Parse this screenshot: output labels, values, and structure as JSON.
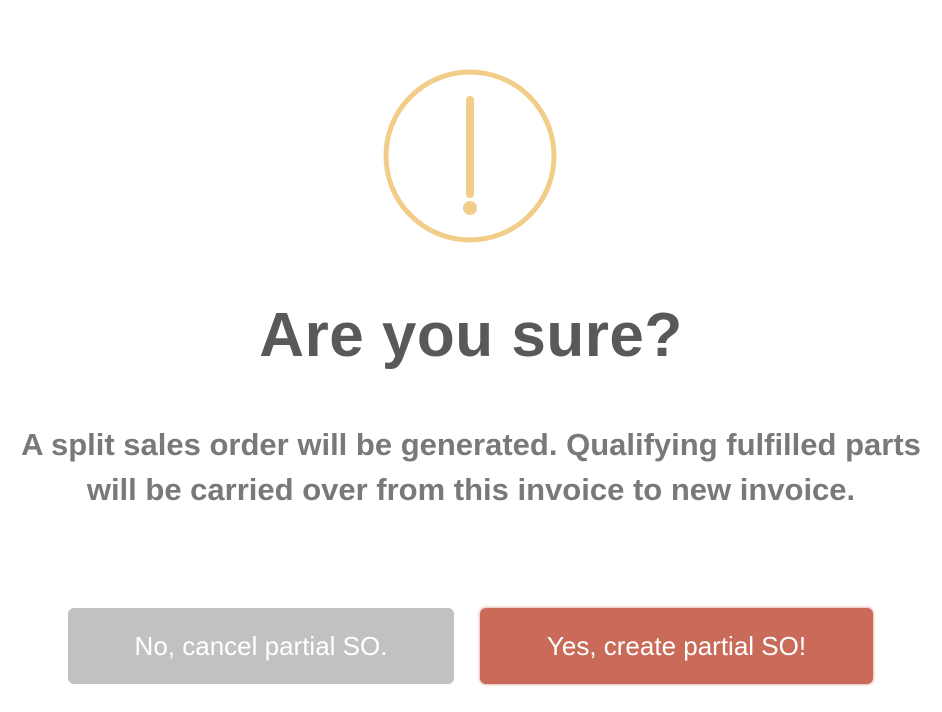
{
  "dialog": {
    "icon": "warning-exclamation-icon",
    "icon_color": "#f2cd8a",
    "title": "Are you sure?",
    "message": "A split sales order will be generated. Qualifying fulfilled parts will be carried over from this invoice to new invoice.",
    "cancel_label": "No, cancel partial SO.",
    "confirm_label": "Yes, create partial SO!",
    "cancel_color": "#c1c1c1",
    "confirm_color": "#c96b58"
  }
}
